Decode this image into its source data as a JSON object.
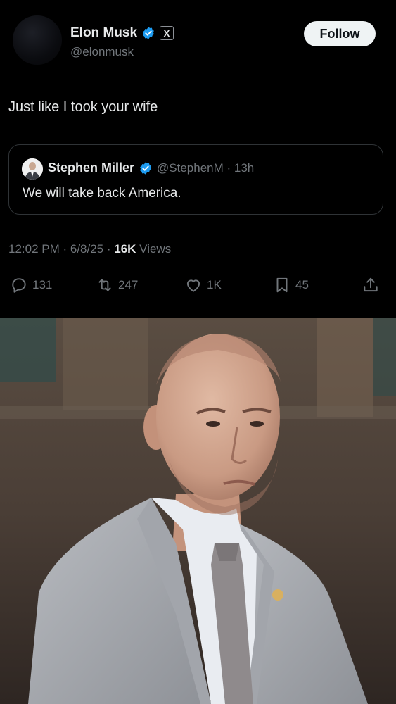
{
  "author": {
    "name": "Elon Musk",
    "handle": "@elonmusk",
    "x_badge": "X",
    "follow_label": "Follow"
  },
  "tweet": {
    "text": "Just like I took your wife"
  },
  "quoted": {
    "name": "Stephen Miller",
    "handle_time": "@StephenM · 13h",
    "text": "We will take back America."
  },
  "meta": {
    "time_date": "12:02 PM · 6/8/25 · ",
    "views_count": "16K",
    "views_label": " Views"
  },
  "actions": {
    "replies": "131",
    "reposts": "247",
    "likes": "1K",
    "bookmarks": "45"
  },
  "icons": [
    "verified-icon",
    "x-badge-icon",
    "reply-icon",
    "repost-icon",
    "like-icon",
    "bookmark-icon",
    "share-icon"
  ],
  "colors": {
    "verified": "#1d9bf0",
    "muted": "#71767b",
    "text": "#e7e9ea",
    "background": "#000000"
  }
}
